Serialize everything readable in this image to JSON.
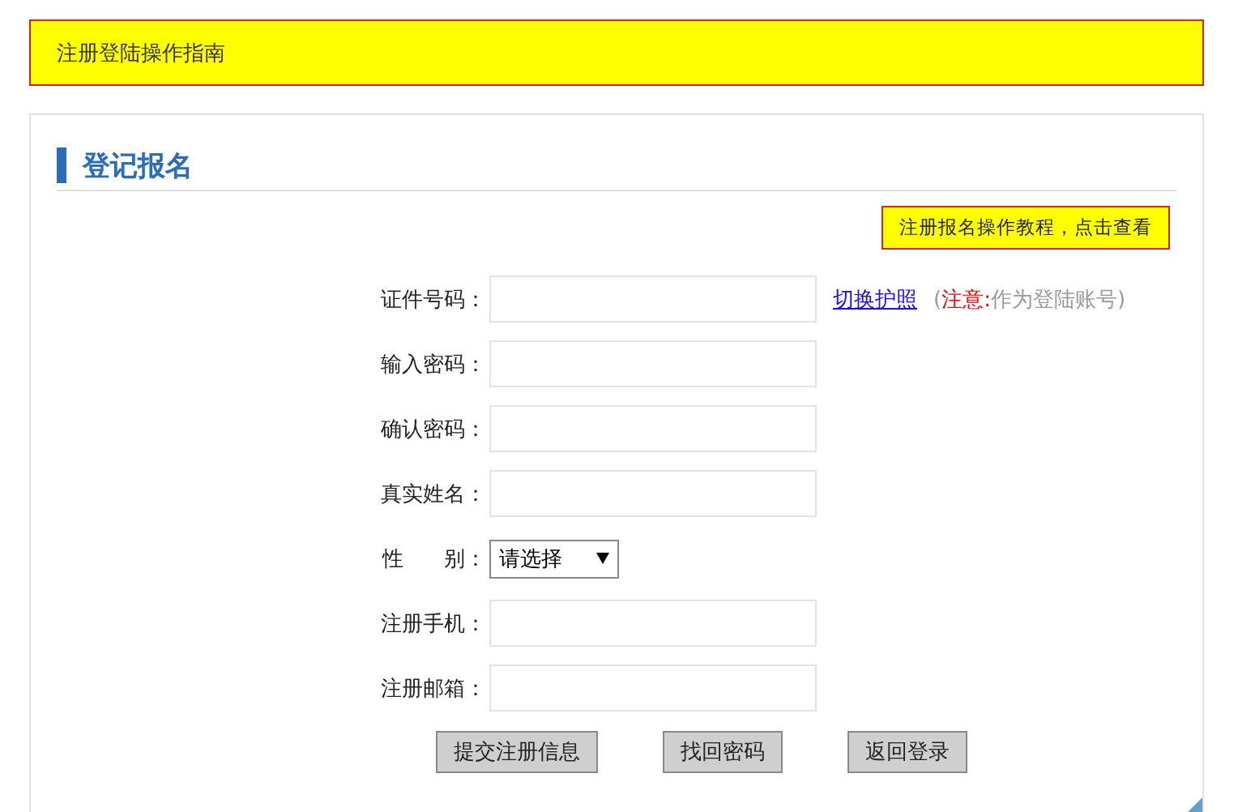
{
  "banner": {
    "title": "注册登陆操作指南"
  },
  "card": {
    "title": "登记报名",
    "tutorial_button": "注册报名操作教程，点击查看"
  },
  "fields": [
    {
      "kind": "text",
      "label": "证件号码：",
      "link": "切换护照",
      "note": {
        "open": "(",
        "warning": "注意:",
        "text": "作为登陆账号)"
      }
    },
    {
      "kind": "text",
      "label": "输入密码："
    },
    {
      "kind": "text",
      "label": "确认密码："
    },
    {
      "kind": "text",
      "label": "真实姓名："
    },
    {
      "kind": "select",
      "label": "性      别：",
      "value": "请选择"
    },
    {
      "kind": "text",
      "label": "注册手机："
    },
    {
      "kind": "text",
      "label": "注册邮箱："
    }
  ],
  "buttons": [
    "提交注册信息",
    "找回密码",
    "返回登录"
  ]
}
